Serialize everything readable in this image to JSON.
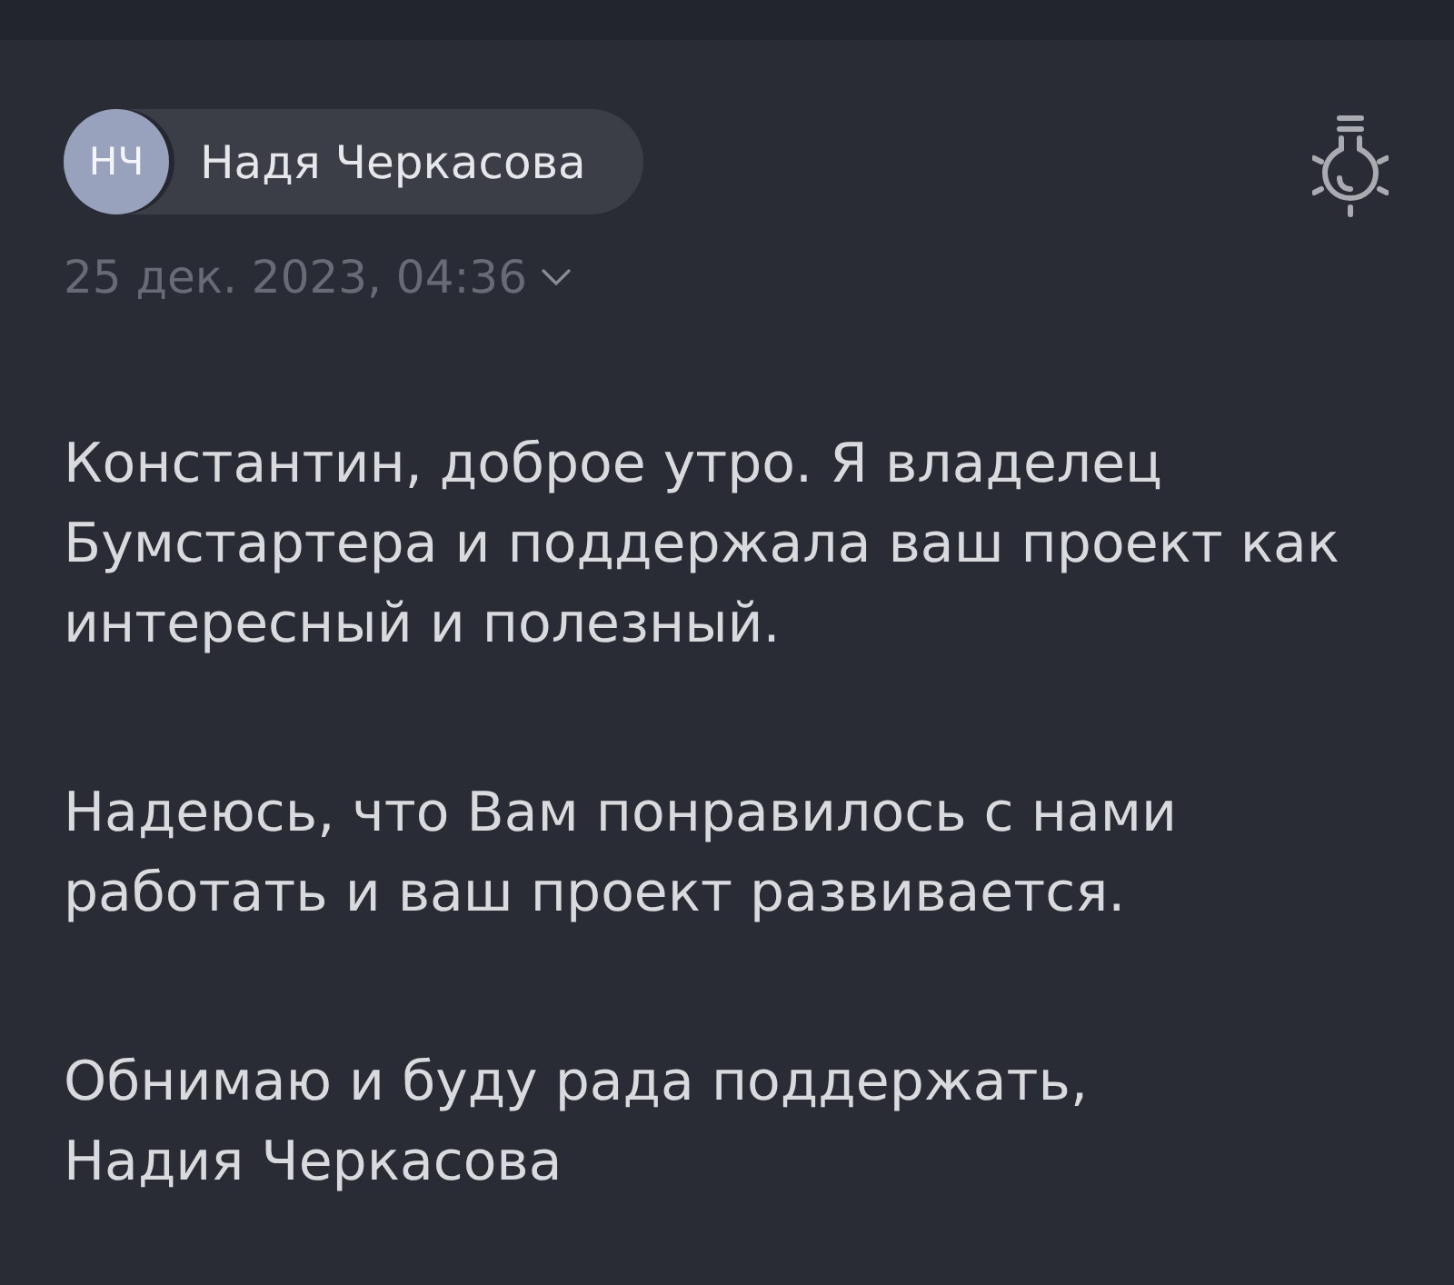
{
  "sender": {
    "initials": "НЧ",
    "name": "Надя Черкасова"
  },
  "date": "25 дек. 2023, 04:36",
  "message": {
    "paragraphs": [
      {
        "lines": [
          "Константин, доброе утро. Я владелец",
          "Бумстартера и поддержала ваш проект как",
          "интересный и полезный."
        ]
      },
      {
        "lines": [
          "Надеюсь, что Вам понравилось с нами",
          "работать и ваш проект развивается."
        ]
      },
      {
        "lines": [
          "Обнимаю и буду рада поддержать,",
          "Надия Черкасова"
        ]
      }
    ]
  }
}
